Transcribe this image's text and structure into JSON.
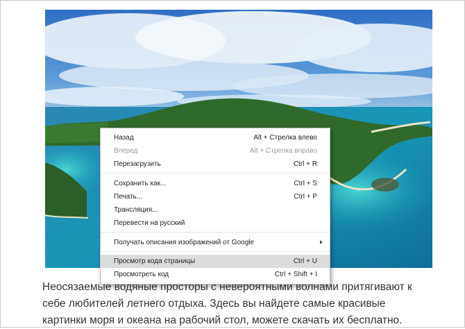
{
  "menu": {
    "items": [
      {
        "label": "Назад",
        "shortcut": "Alt + Стрелка влево"
      },
      {
        "label": "Вперед",
        "shortcut": "Alt + Стрелка вправо"
      },
      {
        "label": "Перезагрузить",
        "shortcut": "Ctrl + R"
      },
      {
        "label": "Сохранить как...",
        "shortcut": "Ctrl + S"
      },
      {
        "label": "Печать...",
        "shortcut": "Ctrl + P"
      },
      {
        "label": "Трансляция..."
      },
      {
        "label": "Перевести на русский"
      },
      {
        "label": "Получать описания изображений от Google"
      },
      {
        "label": "Просмотр кода страницы",
        "shortcut": "Ctrl + U"
      },
      {
        "label": "Просмотреть код",
        "shortcut": "Ctrl + Shift + I"
      }
    ]
  },
  "article": {
    "caption": "Неосязаемые водяные просторы с невероятными волнами притягивают к себе любителей летнего отдыха. Здесь вы найдете самые красивые картинки моря и океана на рабочий стол, можете скачать их бесплатно."
  },
  "colors": {
    "sky": "#3d7fd0",
    "sea": "#1a8fb8",
    "island": "#2f6a2b",
    "menu_highlight": "#dcdcdc"
  }
}
